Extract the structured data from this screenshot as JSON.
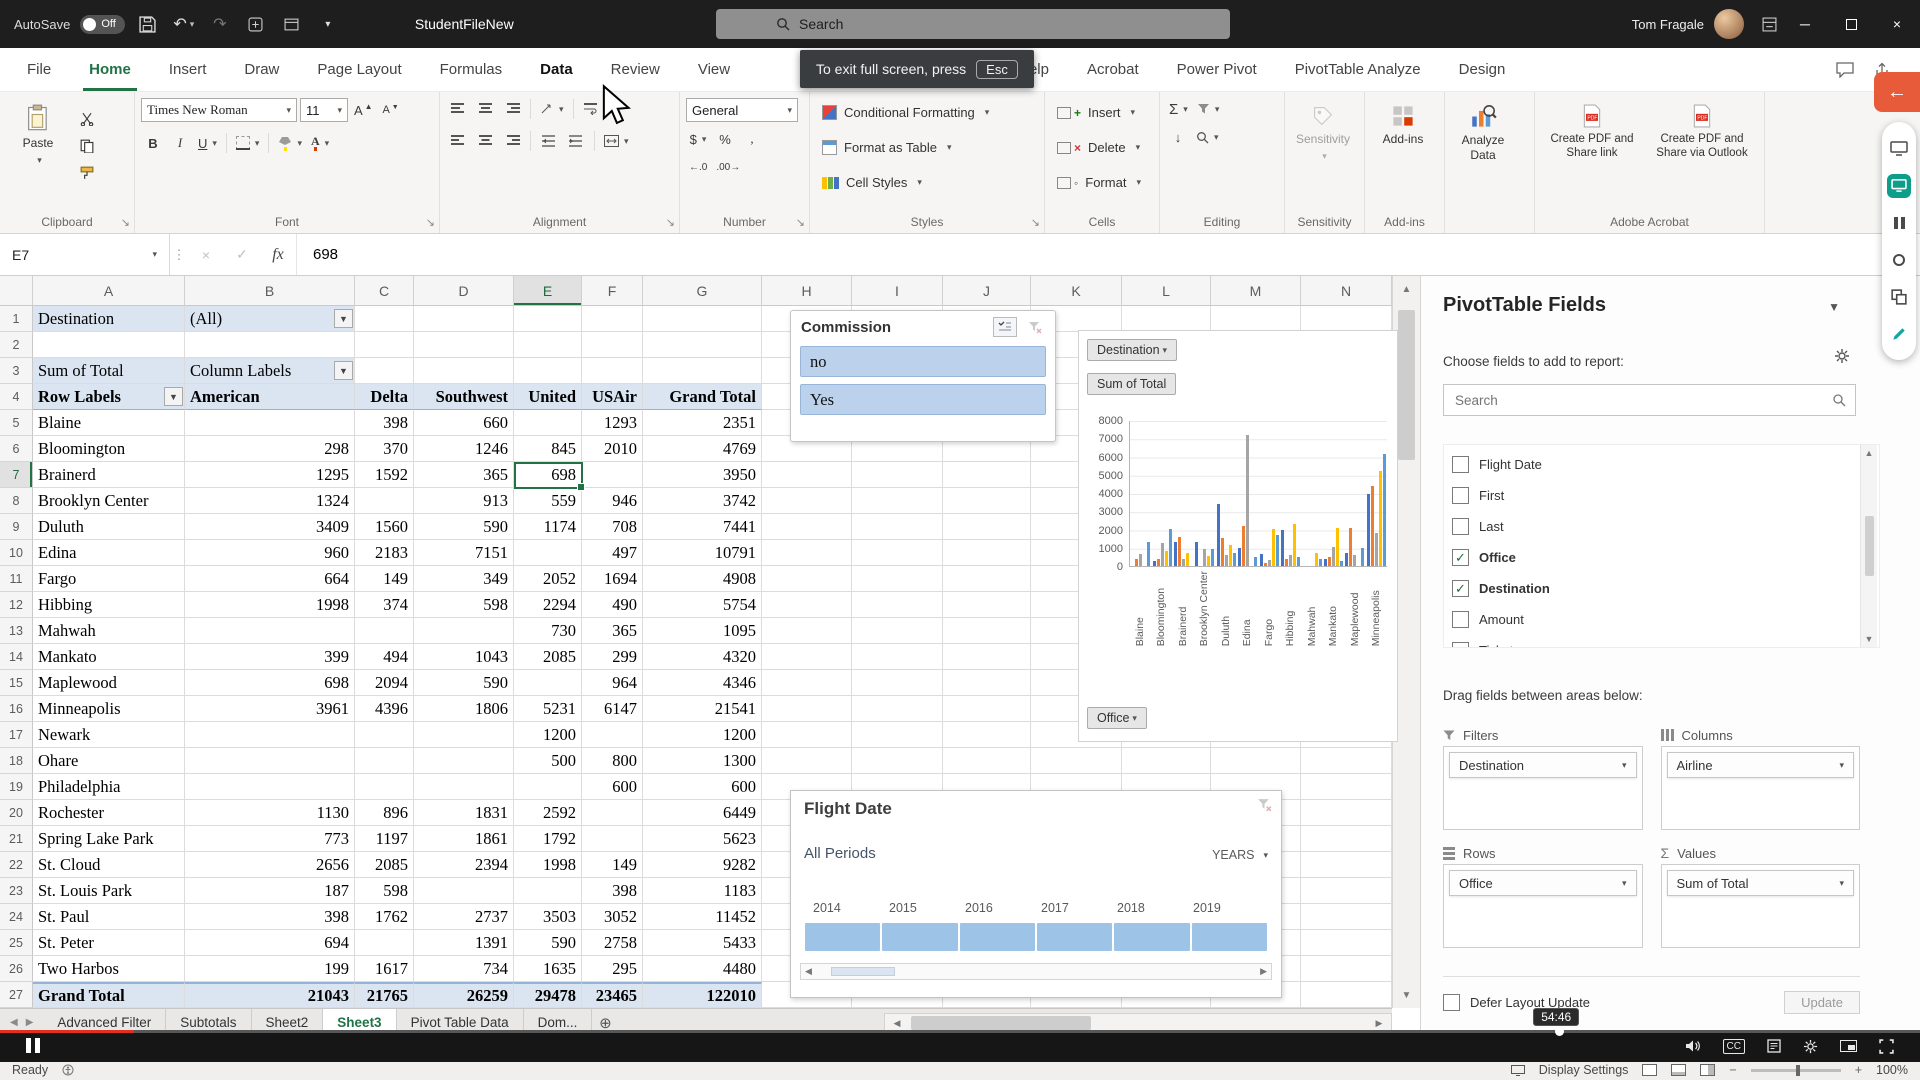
{
  "titlebar": {
    "autosave_label": "AutoSave",
    "autosave_state": "Off",
    "workbook_title": "StudentFileNew",
    "search_placeholder": "Search",
    "user_name": "Tom Fragale"
  },
  "ribbon": {
    "tabs": [
      {
        "label": "File"
      },
      {
        "label": "Home",
        "active": true
      },
      {
        "label": "Insert"
      },
      {
        "label": "Draw"
      },
      {
        "label": "Page Layout"
      },
      {
        "label": "Formulas"
      },
      {
        "label": "Data",
        "bold": true
      },
      {
        "label": "Review"
      },
      {
        "label": "View"
      },
      {
        "label": "Help"
      },
      {
        "label": "Acrobat"
      },
      {
        "label": "Power Pivot"
      },
      {
        "label": "PivotTable Analyze"
      },
      {
        "label": "Design"
      }
    ],
    "font_name": "Times New Roman",
    "font_size": "11",
    "number_format": "General",
    "groups": [
      "Clipboard",
      "Font",
      "Alignment",
      "Number",
      "Styles",
      "Cells",
      "Editing",
      "Sensitivity",
      "Add-ins",
      "Adobe Acrobat"
    ],
    "buttons": {
      "paste": "Paste",
      "conditional_formatting": "Conditional Formatting",
      "format_as_table": "Format as Table",
      "cell_styles": "Cell Styles",
      "insert": "Insert",
      "delete": "Delete",
      "format": "Format",
      "sensitivity": "Sensitivity",
      "addins": "Add-ins",
      "analyze_data": "Analyze Data",
      "create_pdf_share": "Create PDF and Share link",
      "create_pdf_outlook": "Create PDF and Share via Outlook"
    }
  },
  "tooltip": {
    "text": "To exit full screen, press",
    "key": "Esc"
  },
  "formula_bar": {
    "cell": "E7",
    "value": "698"
  },
  "grid": {
    "columns": [
      "A",
      "B",
      "C",
      "D",
      "E",
      "F",
      "G",
      "H",
      "I",
      "J",
      "K",
      "L",
      "M",
      "N"
    ],
    "selected_cell": "E7",
    "selected_column": "E",
    "selected_row": 7
  },
  "pivot": {
    "filter_label": "Destination",
    "filter_value": "(All)",
    "value_label": "Sum of Total",
    "column_labels": "Column Labels",
    "row_labels": "Row Labels",
    "col_headers": [
      "American",
      "Delta",
      "Southwest",
      "United",
      "USAir",
      "Grand Total"
    ],
    "data_rows": [
      [
        "Blaine",
        "",
        "398",
        "660",
        "",
        "1293",
        "2351"
      ],
      [
        "Bloomington",
        "298",
        "370",
        "1246",
        "845",
        "2010",
        "4769"
      ],
      [
        "Brainerd",
        "1295",
        "1592",
        "365",
        "698",
        "",
        "3950"
      ],
      [
        "Brooklyn Center",
        "1324",
        "",
        "913",
        "559",
        "946",
        "3742"
      ],
      [
        "Duluth",
        "3409",
        "1560",
        "590",
        "1174",
        "708",
        "7441"
      ],
      [
        "Edina",
        "960",
        "2183",
        "7151",
        "",
        "497",
        "10791"
      ],
      [
        "Fargo",
        "664",
        "149",
        "349",
        "2052",
        "1694",
        "4908"
      ],
      [
        "Hibbing",
        "1998",
        "374",
        "598",
        "2294",
        "490",
        "5754"
      ],
      [
        "Mahwah",
        "",
        "",
        "",
        "730",
        "365",
        "1095"
      ],
      [
        "Mankato",
        "399",
        "494",
        "1043",
        "2085",
        "299",
        "4320"
      ],
      [
        "Maplewood",
        "698",
        "2094",
        "590",
        "",
        "964",
        "4346"
      ],
      [
        "Minneapolis",
        "3961",
        "4396",
        "1806",
        "5231",
        "6147",
        "21541"
      ],
      [
        "Newark",
        "",
        "",
        "",
        "1200",
        "",
        "1200"
      ],
      [
        "Ohare",
        "",
        "",
        "",
        "500",
        "800",
        "1300"
      ],
      [
        "Philadelphia",
        "",
        "",
        "",
        "",
        "600",
        "600"
      ],
      [
        "Rochester",
        "1130",
        "896",
        "1831",
        "2592",
        "",
        "6449"
      ],
      [
        "Spring Lake Park",
        "773",
        "1197",
        "1861",
        "1792",
        "",
        "5623"
      ],
      [
        "St. Cloud",
        "2656",
        "2085",
        "2394",
        "1998",
        "149",
        "9282"
      ],
      [
        "St. Louis Park",
        "187",
        "598",
        "",
        "",
        "398",
        "1183"
      ],
      [
        "St. Paul",
        "398",
        "1762",
        "2737",
        "3503",
        "3052",
        "11452"
      ],
      [
        "St. Peter",
        "694",
        "",
        "1391",
        "590",
        "2758",
        "5433"
      ],
      [
        "Two Harbos",
        "199",
        "1617",
        "734",
        "1635",
        "295",
        "4480"
      ]
    ],
    "grand_total": [
      "Grand Total",
      "21043",
      "21765",
      "26259",
      "29478",
      "23465",
      "122010"
    ]
  },
  "slicer": {
    "title": "Commission",
    "items": [
      {
        "label": "no",
        "selected": true
      },
      {
        "label": "Yes",
        "selected": true
      }
    ]
  },
  "chart": {
    "field_buttons": {
      "top": "Destination",
      "series": "Sum of Total",
      "axis": "Office"
    }
  },
  "chart_data": {
    "type": "bar",
    "title": "",
    "categories": [
      "Blaine",
      "Bloomington",
      "Brainerd",
      "Brooklyn Center",
      "Duluth",
      "Edina",
      "Fargo",
      "Hibbing",
      "Mahwah",
      "Mankato",
      "Maplewood",
      "Minneapolis"
    ],
    "series": [
      {
        "name": "American",
        "color": "#4472c4",
        "values": [
          0,
          298,
          1295,
          1324,
          3409,
          960,
          664,
          1998,
          0,
          399,
          698,
          3961
        ]
      },
      {
        "name": "Delta",
        "color": "#ed7d31",
        "values": [
          398,
          370,
          1592,
          0,
          1560,
          2183,
          149,
          374,
          0,
          494,
          2094,
          4396
        ]
      },
      {
        "name": "Southwest",
        "color": "#a5a5a5",
        "values": [
          660,
          1246,
          365,
          913,
          590,
          7151,
          349,
          598,
          0,
          1043,
          590,
          1806
        ]
      },
      {
        "name": "United",
        "color": "#ffc000",
        "values": [
          0,
          845,
          698,
          559,
          1174,
          0,
          2052,
          2294,
          730,
          2085,
          0,
          5231
        ]
      },
      {
        "name": "USAir",
        "color": "#5b9bd5",
        "values": [
          1293,
          2010,
          0,
          946,
          708,
          497,
          1694,
          490,
          365,
          299,
          964,
          6147
        ]
      }
    ],
    "ylim": [
      0,
      8000
    ],
    "y_ticks": [
      "8000",
      "7000",
      "6000",
      "5000",
      "4000",
      "3000",
      "2000",
      "1000",
      "0"
    ],
    "xlabel": "",
    "ylabel": "",
    "legend": "none",
    "grid": true
  },
  "timeline": {
    "title": "Flight Date",
    "range": "All Periods",
    "granularity": "YEARS",
    "years": [
      "2014",
      "2015",
      "2016",
      "2017",
      "2018",
      "2019"
    ]
  },
  "fields_panel": {
    "title": "PivotTable Fields",
    "choose_label": "Choose fields to add to report:",
    "search_placeholder": "Search",
    "fields": [
      {
        "label": "Flight Date",
        "checked": false
      },
      {
        "label": "First",
        "checked": false
      },
      {
        "label": "Last",
        "checked": false
      },
      {
        "label": "Office",
        "checked": true
      },
      {
        "label": "Destination",
        "checked": true
      },
      {
        "label": "Amount",
        "checked": false
      },
      {
        "label": "Tickets",
        "checked": false
      }
    ],
    "drag_label": "Drag fields between areas below:",
    "areas": {
      "filters": {
        "title": "Filters",
        "items": [
          "Destination"
        ]
      },
      "columns": {
        "title": "Columns",
        "items": [
          "Airline"
        ]
      },
      "rows": {
        "title": "Rows",
        "items": [
          "Office"
        ]
      },
      "values": {
        "title": "Values",
        "items": [
          "Sum of Total"
        ]
      }
    },
    "defer_label": "Defer Layout Update",
    "update_label": "Update"
  },
  "sheet_tabs": {
    "tabs": [
      {
        "label": "Advanced Filter"
      },
      {
        "label": "Subtotals"
      },
      {
        "label": "Sheet2"
      },
      {
        "label": "Sheet3",
        "active": true
      },
      {
        "label": "Pivot Table Data"
      },
      {
        "label": "Dom..."
      }
    ]
  },
  "status_bar": {
    "ready": "Ready",
    "display_settings": "Display Settings",
    "zoom": "100%"
  },
  "video_player": {
    "time": "54:46"
  }
}
